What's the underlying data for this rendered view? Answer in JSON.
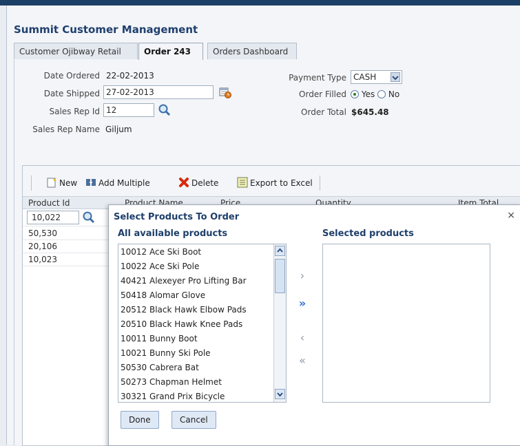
{
  "app": {
    "title": "Summit Customer Management"
  },
  "tabs": [
    {
      "label": "Customer Ojibway Retail"
    },
    {
      "label": "Order 243"
    },
    {
      "label": "Orders Dashboard"
    }
  ],
  "order": {
    "date_ordered_label": "Date Ordered",
    "date_ordered": "22-02-2013",
    "date_shipped_label": "Date Shipped",
    "date_shipped": "27-02-2013",
    "sales_rep_id_label": "Sales Rep Id",
    "sales_rep_id": "12",
    "sales_rep_name_label": "Sales Rep Name",
    "sales_rep_name": "Giljum",
    "payment_type_label": "Payment Type",
    "payment_type": "CASH",
    "order_filled_label": "Order Filled",
    "order_filled_yes": "Yes",
    "order_filled_no": "No",
    "order_filled_value": "Yes",
    "order_total_label": "Order Total",
    "order_total": "$645.48"
  },
  "toolbar": {
    "new_label": "New",
    "add_multiple_label": "Add Multiple",
    "delete_label": "Delete",
    "export_label": "Export to Excel"
  },
  "table": {
    "headers": [
      "Product Id",
      "Product Name",
      "Price",
      "Quantity",
      "Item Total"
    ],
    "rows": [
      "10,022",
      "50,530",
      "20,106",
      "10,023"
    ]
  },
  "dialog": {
    "title": "Select Products To Order",
    "available_title": "All available products",
    "selected_title": "Selected products",
    "available_items": [
      "10012 Ace Ski Boot",
      "10022 Ace Ski Pole",
      "40421 Alexeyer Pro Lifting Bar",
      "50418 Alomar Glove",
      "20512 Black Hawk Elbow Pads",
      "20510 Black Hawk Knee Pads",
      "10011 Bunny Boot",
      "10021 Bunny Ski Pole",
      "50530 Cabrera Bat",
      "50273 Chapman Helmet",
      "30321 Grand Prix Bicycle"
    ],
    "selected_items": [],
    "move_icons": [
      "›",
      "»",
      "‹",
      "«"
    ],
    "done_label": "Done",
    "cancel_label": "Cancel",
    "close_glyph": "×"
  },
  "colors": {
    "title_blue": "#203f6f",
    "accent_blue": "#2d6ed2",
    "button_bg": "#dfe9f6"
  }
}
